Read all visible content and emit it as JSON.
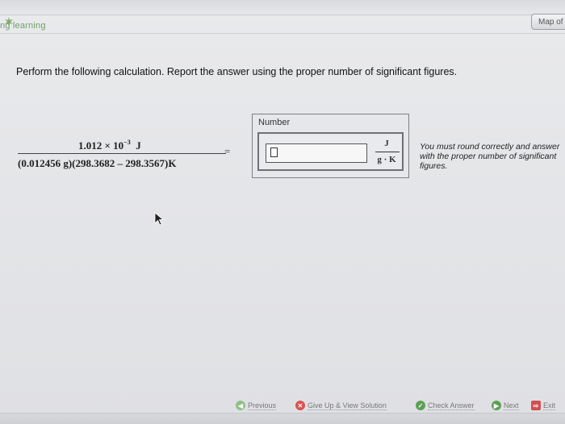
{
  "header": {
    "brand_text": "ng learning",
    "map_button_label": "Map of"
  },
  "question": {
    "prompt": "Perform the following calculation. Report the answer using the proper number of significant figures.",
    "numerator": {
      "mantissa": "1.012 × 10",
      "exponent": "−3",
      "unit": "J"
    },
    "denominator": "(0.012456  g)(298.3682 – 298.3567)K",
    "equals": "="
  },
  "answer": {
    "panel_label": "Number",
    "input_value": "",
    "unit_numerator": "J",
    "unit_denominator": "g · K",
    "hint": "You must round correctly and answer with the proper number of significant figures."
  },
  "nav": {
    "previous": "Previous",
    "give_up": "Give Up & View Solution",
    "check_answer": "Check Answer",
    "next": "Next",
    "exit": "Exit"
  },
  "colors": {
    "brand_green": "#6f9e6a",
    "give_up_red": "#d9534f",
    "check_green": "#5ba153",
    "next_green": "#5ba153"
  }
}
